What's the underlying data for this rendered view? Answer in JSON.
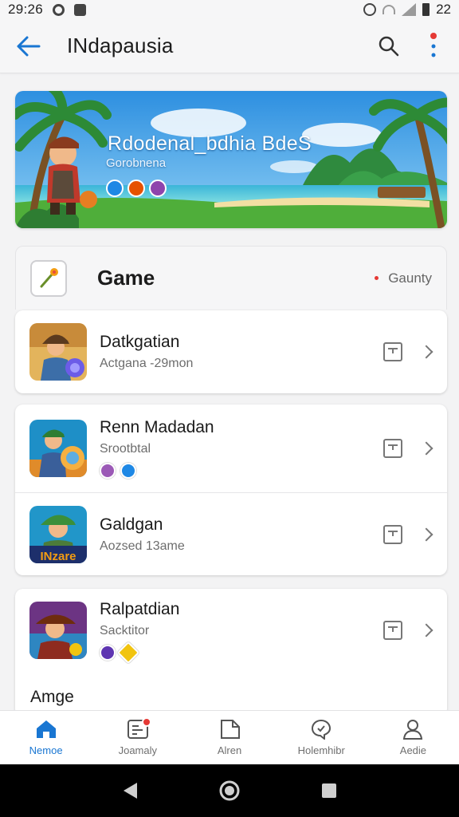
{
  "status_bar": {
    "time": "29:26",
    "right_text": "22"
  },
  "app_bar": {
    "title": "INdapausia"
  },
  "banner": {
    "title": "Rdodenal_bdhia BdeS",
    "subtitle": "Gorobnena"
  },
  "section": {
    "title": "Game",
    "filter_label": "Gaunty"
  },
  "games": [
    {
      "name": "Datkgatian",
      "subtitle": "Actgana -29mon"
    },
    {
      "name": "Renn Madadan",
      "subtitle": "Srootbtal"
    },
    {
      "name": "Galdgan",
      "subtitle": "Aozsed 13ame",
      "thumb_text": "INzare"
    },
    {
      "name": "Ralpatdian",
      "subtitle": "Sacktitor"
    }
  ],
  "peek_label": "Amge",
  "bottom_nav": [
    {
      "label": "Nemoe",
      "icon": "home-icon"
    },
    {
      "label": "Joamaly",
      "icon": "journal-icon"
    },
    {
      "label": "Alren",
      "icon": "document-icon"
    },
    {
      "label": "Holemhibr",
      "icon": "chat-icon"
    },
    {
      "label": "Aedie",
      "icon": "profile-icon"
    }
  ],
  "colors": {
    "accent": "#1976d2",
    "notification": "#e53935",
    "background": "#f3f3f4"
  }
}
